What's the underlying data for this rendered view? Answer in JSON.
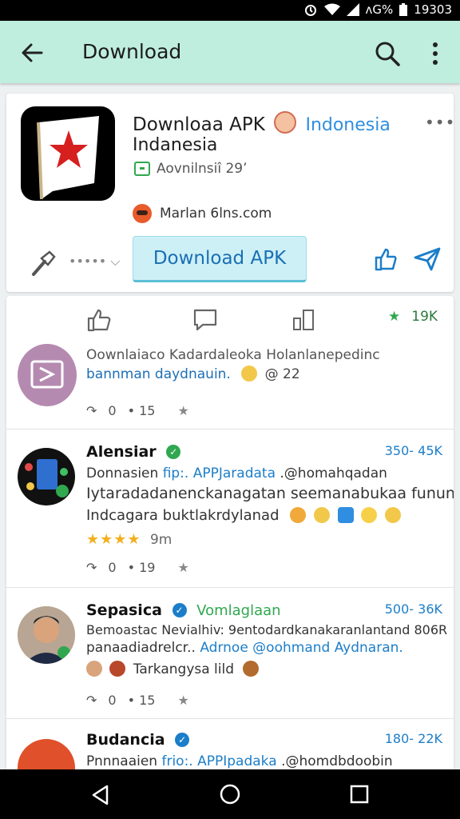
{
  "status_bar": {
    "network": "ᴧG%",
    "time": "19303"
  },
  "app_bar": {
    "title": "Download"
  },
  "app_card": {
    "name": "Downloaa APK",
    "country": "Indonesia",
    "subtitle": "Indanesia",
    "meta": "Aovnilnsiî 29’",
    "site": "Marlan 6lns.com",
    "tool_dots": "••••• ⌵",
    "download_label": "Download APK",
    "menu": "•••"
  },
  "feed": {
    "stars": "19K",
    "promo": {
      "line1": "Oownlaiaco Kadardaleoka Holanlanepedinc",
      "line2_link": "bannman daydnauin.",
      "line2_extra": "@ 22",
      "zero": "0",
      "dots": "• 15"
    },
    "posts": [
      {
        "name": "Alensiar",
        "handle": "",
        "count": "350- 45K",
        "line1_text": "Donnasien",
        "line1_link": "fip:. APPJaradata",
        "line1_rest": ".@homahqadan",
        "line2": "Iytaradadanenckanagatan seemanabukaa fununan",
        "line3": "Indcagara buktlakrdylanad",
        "line4": "9m",
        "zero": "0",
        "dots": "• 19"
      },
      {
        "name": "Sepasica",
        "handle": "Vomlaglaan",
        "count": "500- 36K",
        "line1_text": "Bemoastac Nevialhiv: 9entodardkanakaranlantand 806R",
        "line2_text": "panaadiadrelcr..",
        "line2_link": "Adrnoe @oohmand Aydnaran.",
        "line3": "Tarkangysa lild",
        "zero": "0",
        "dots": "• 15"
      },
      {
        "name": "Budancia",
        "count": "180- 22K",
        "line1_text": "Pnnnaaien",
        "line1_link": "frio:. APPIpadaka",
        "line1_rest": ".@homdbdoobin"
      }
    ]
  }
}
